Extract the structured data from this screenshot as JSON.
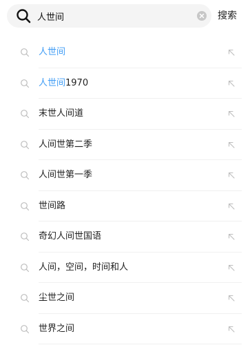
{
  "search": {
    "value": "人世间",
    "submit_label": "搜索"
  },
  "suggestions": [
    {
      "highlight": "人世间",
      "rest": ""
    },
    {
      "highlight": "人世间",
      "rest": "1970"
    },
    {
      "highlight": "",
      "rest": "末世人间道"
    },
    {
      "highlight": "",
      "rest": "人间世第二季"
    },
    {
      "highlight": "",
      "rest": "人间世第一季"
    },
    {
      "highlight": "",
      "rest": "世间路"
    },
    {
      "highlight": "",
      "rest": "奇幻人间世国语"
    },
    {
      "highlight": "",
      "rest": "人间，空间，时间和人"
    },
    {
      "highlight": "",
      "rest": "尘世之间"
    },
    {
      "highlight": "",
      "rest": "世界之间"
    }
  ],
  "colors": {
    "highlight": "#3f9cf5",
    "text": "#222222",
    "icon": "#bdbdbd"
  },
  "icons": {
    "search": "search-icon",
    "clear": "clear-icon",
    "suggestion": "search-icon",
    "fill": "arrow-up-left-icon"
  }
}
